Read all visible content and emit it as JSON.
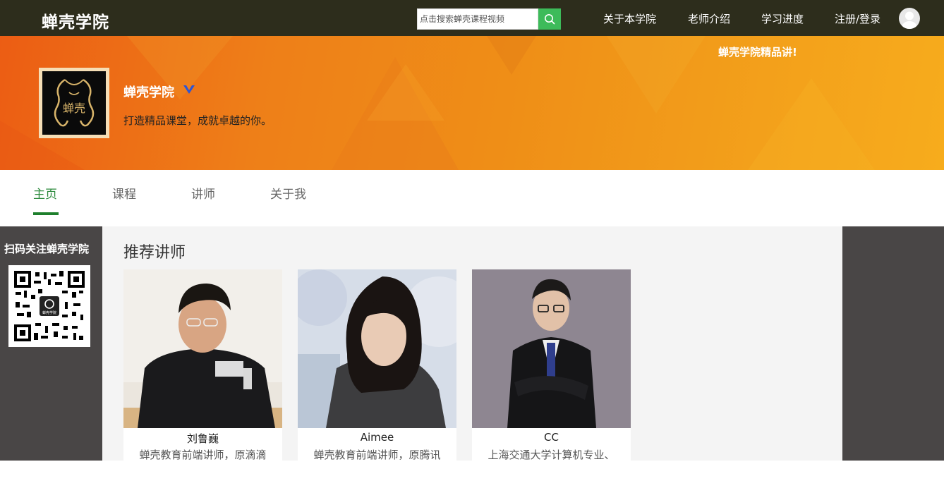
{
  "header": {
    "brand": "蝉壳学院",
    "search": {
      "placeholder": "点击搜索蝉壳课程视频",
      "value": ""
    },
    "search_button_icon": "search-icon",
    "nav": [
      {
        "label": "关于本学院"
      },
      {
        "label": "老师介绍"
      },
      {
        "label": "学习进度"
      },
      {
        "label": "注册/登录"
      }
    ],
    "avatar_icon": "user-avatar-icon"
  },
  "banner": {
    "slogan": "蝉壳学院精品讲!",
    "channel_name": "蝉壳学院",
    "verified_icon": "verified-v-icon",
    "description": "打造精品课堂，成就卓越的你。",
    "logo_text": "蝉壳",
    "colors": {
      "start": "#ec5d14",
      "end": "#f7ac1c"
    }
  },
  "tabs": [
    {
      "label": "主页",
      "active": true
    },
    {
      "label": "课程",
      "active": false
    },
    {
      "label": "讲师",
      "active": false
    },
    {
      "label": "关于我",
      "active": false
    }
  ],
  "sidebar": {
    "qr_title": "扫码关注蝉壳学院",
    "qr_center_text": "蝉壳学院"
  },
  "main": {
    "section_title": "推荐讲师",
    "teachers": [
      {
        "name": "刘鲁巍",
        "bio": "蝉壳教育前端讲师，原滴滴"
      },
      {
        "name": "Aimee",
        "bio": "蝉壳教育前端讲师，原腾讯"
      },
      {
        "name": "CC",
        "bio": "上海交通大学计算机专业、"
      }
    ]
  },
  "colors": {
    "topbar": "#2d2d1c",
    "accent_green": "#2e8b3e",
    "search_button": "#3dbb5a",
    "side_panels": "#494646"
  }
}
